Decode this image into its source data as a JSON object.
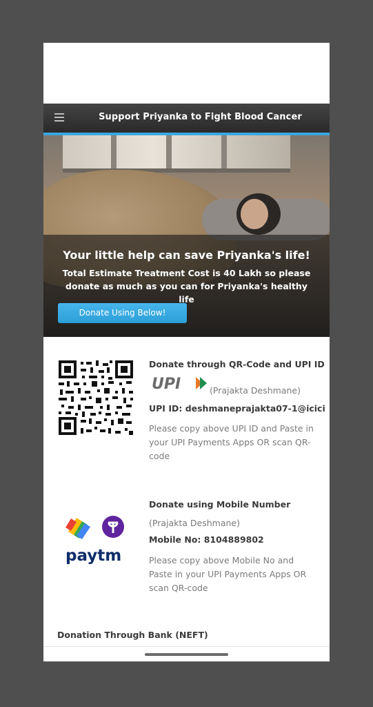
{
  "header": {
    "title": "Support Priyanka to Fight Blood Cancer",
    "menu_icon": "hamburger-menu-icon",
    "accent_color": "#3aa8e0"
  },
  "hero": {
    "heading": "Your little help can save Priyanka's life!",
    "subtext": "Total Estimate Treatment Cost is 40 Lakh so please donate as much as you can for Priyanka's healthy life",
    "button_label": "Donate Using Below!",
    "button_color": "#3aa8e0"
  },
  "upi_section": {
    "title": "Donate through QR-Code and UPI ID",
    "logo_text": "UPI",
    "payee": "(Prajakta Deshmane)",
    "upi_id": "UPI ID: deshmaneprajakta07-1@icici",
    "instructions": "Please copy above UPI ID and Paste in your UPI Payments Apps OR scan QR-code"
  },
  "mobile_section": {
    "title": "Donate using Mobile Number",
    "payee": "(Prajakta Deshmane)",
    "mobile": "Mobile No: 8104889802",
    "instructions": "Please copy above Mobile No and Paste in your UPI Payments Apps OR scan QR-code",
    "paytm_label": "paytm",
    "icons": [
      "google-pay-icon",
      "phonepe-icon",
      "paytm-logo"
    ]
  },
  "bank_section": {
    "title": "Donation Through Bank (NEFT)"
  }
}
